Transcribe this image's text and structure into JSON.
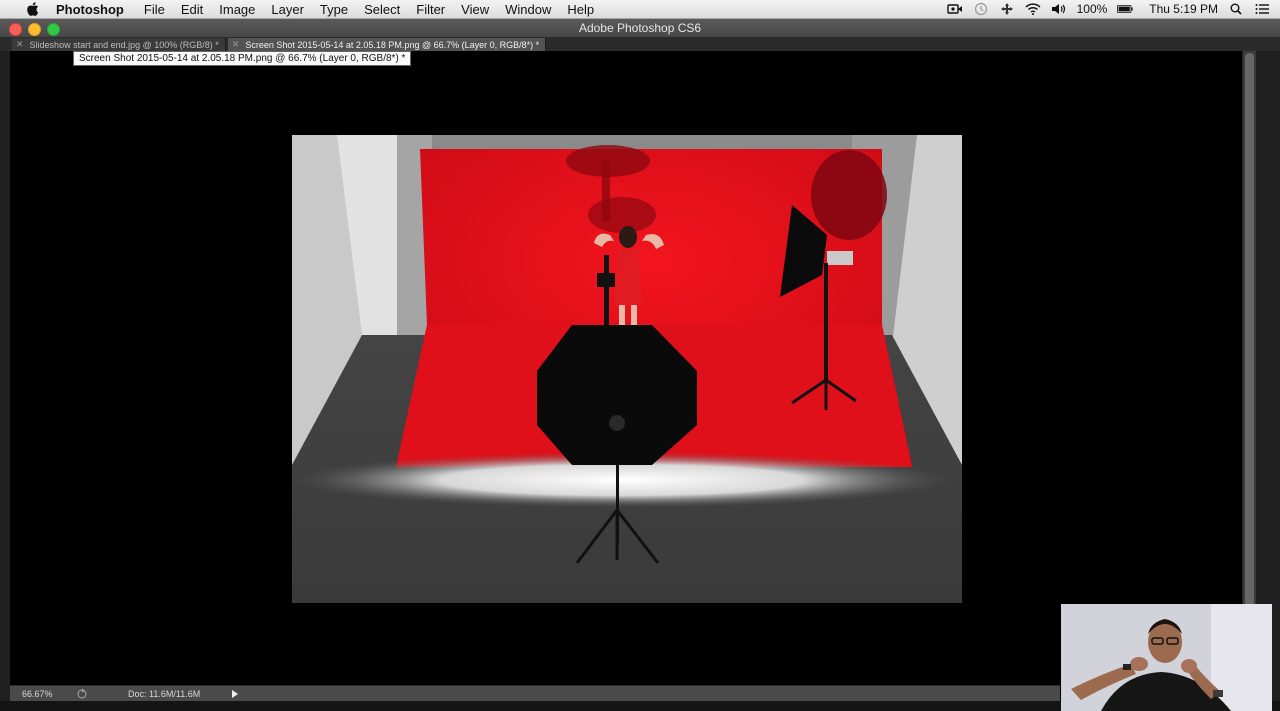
{
  "menubar": {
    "app_name": "Photoshop",
    "menus": [
      "File",
      "Edit",
      "Image",
      "Layer",
      "Type",
      "Select",
      "Filter",
      "View",
      "Window",
      "Help"
    ],
    "battery": "100%",
    "clock": "Thu 5:19 PM"
  },
  "window": {
    "title": "Adobe Photoshop CS6"
  },
  "tabs": [
    {
      "label": "Slideshow start and end.jpg @ 100% (RGB/8) *",
      "active": false
    },
    {
      "label": "Screen Shot 2015-05-14 at 2.05.18 PM.png @ 66.7% (Layer 0, RGB/8*) *",
      "active": true
    }
  ],
  "tooltip": "Screen Shot 2015-05-14 at 2.05.18 PM.png @ 66.7% (Layer 0, RGB/8*) *",
  "statusbar": {
    "zoom": "66.67%",
    "doc_info": "Doc: 11.6M/11.6M"
  },
  "colors": {
    "backdrop_red": "#e3101c",
    "menubar_bg": "#e8e8e8",
    "window_chrome": "#4f4f4f"
  }
}
